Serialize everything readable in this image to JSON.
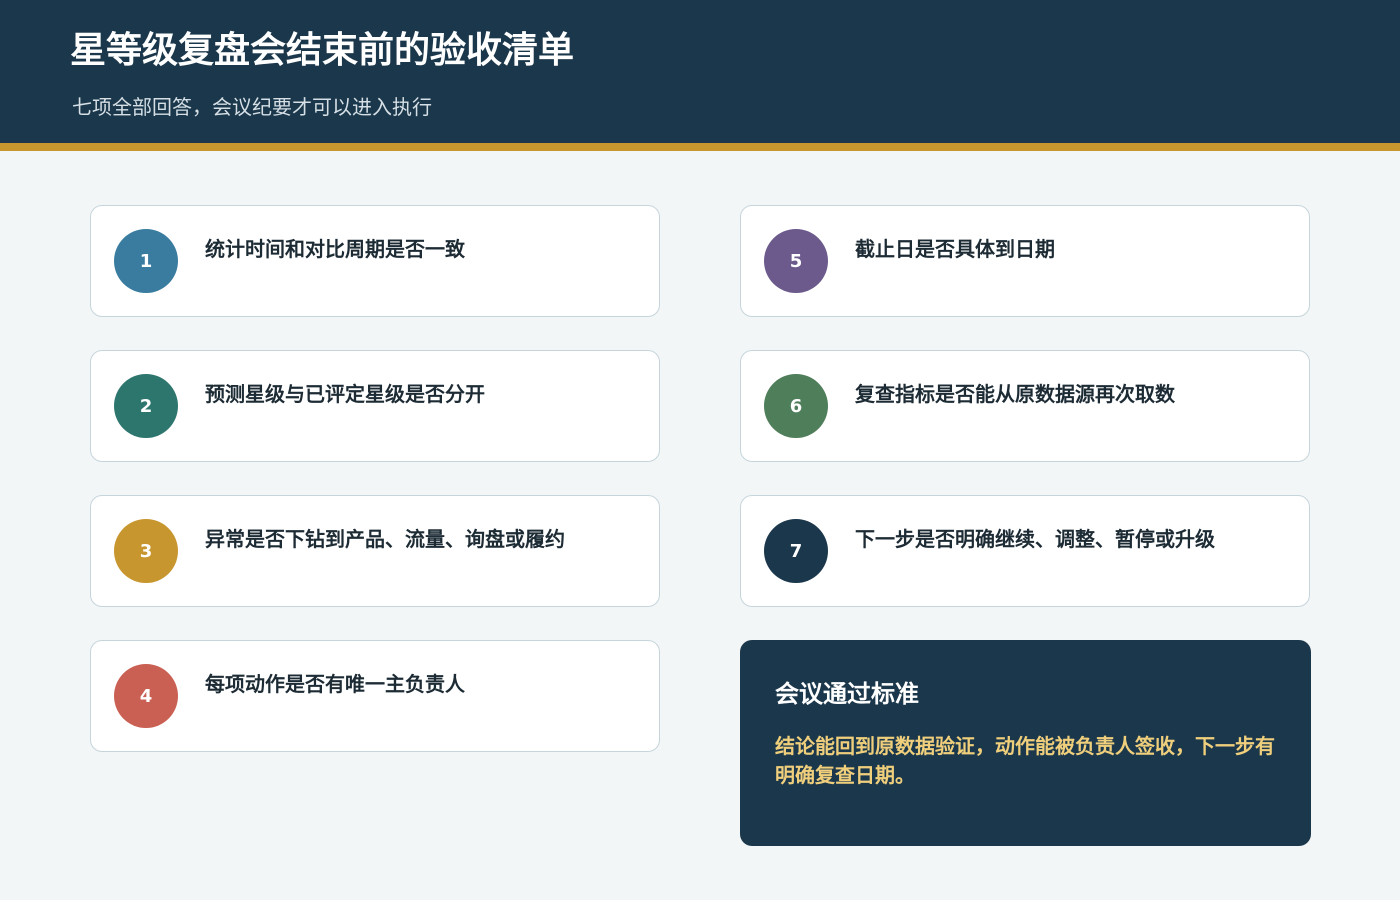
{
  "header": {
    "title": "星等级复盘会结束前的验收清单",
    "subtitle": "七项全部回答，会议纪要才可以进入执行",
    "background_color": "#1b374b",
    "accent_color": "#c8962f"
  },
  "checklist": [
    {
      "number": "1",
      "text": "统计时间和对比周期是否一致",
      "color": "#3a7ca0"
    },
    {
      "number": "2",
      "text": "预测星级与已评定星级是否分开",
      "color": "#2d766e"
    },
    {
      "number": "3",
      "text": "异常是否下钻到产品、流量、询盘或履约",
      "color": "#c8962f"
    },
    {
      "number": "4",
      "text": "每项动作是否有唯一主负责人",
      "color": "#c96053"
    },
    {
      "number": "5",
      "text": "截止日是否具体到日期",
      "color": "#6b5a8b"
    },
    {
      "number": "6",
      "text": "复查指标是否能从原数据源再次取数",
      "color": "#4f7e5b"
    },
    {
      "number": "7",
      "text": "下一步是否明确继续、调整、暂停或升级",
      "color": "#1b374b"
    }
  ],
  "summary": {
    "title": "会议通过标准",
    "body": "结论能回到原数据验证，动作能被负责人签收，下一步有明确复查日期。"
  }
}
